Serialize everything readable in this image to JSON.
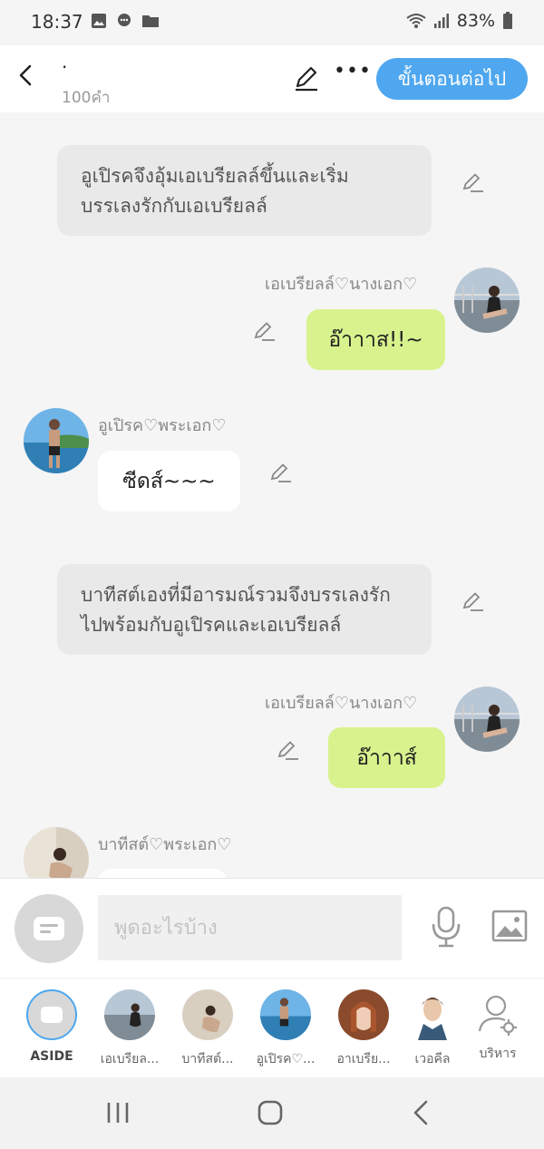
{
  "status_bar": {
    "time": "18:37",
    "battery": "83%"
  },
  "header": {
    "title": "·",
    "word_count": "100คำ",
    "next_label": "ขั้นตอนต่อไป"
  },
  "messages": {
    "narration_1": "อูเปิรคจึงอุ้มเอเบรียลล์ขึ้นและเริ่มบรรเลงรักกับเอเบรียลล์",
    "msg_1": {
      "name": "เอเบรียลล์♡นางเอก♡",
      "text": "อ๊าาาส!!~"
    },
    "msg_2": {
      "name": "อูเปิรค♡พระเอก♡",
      "text": "ซีดส์~~~"
    },
    "narration_2": "บาทีสต์เองที่มีอารมณ์รวมจึงบรรเลงรักไปพร้อมกับอูเปิรคและเอเบรียลล์",
    "msg_3": {
      "name": "เอเบรียลล์♡นางเอก♡",
      "text": "อ๊าาาส์"
    },
    "msg_4": {
      "name": "บาทีสต์♡พระเอก♡"
    }
  },
  "input": {
    "placeholder": "พูดอะไรบ้าง"
  },
  "characters": [
    {
      "label": "ASIDE"
    },
    {
      "label": "เอเบรียล..."
    },
    {
      "label": "บาทีสต์..."
    },
    {
      "label": "อูเปิรค♡..."
    },
    {
      "label": "อาเบรีย..."
    },
    {
      "label": "เวอคีล"
    },
    {
      "label": "บริหาร"
    }
  ],
  "colors": {
    "accent": "#4ea7ef",
    "bubble_right": "#d8f38d",
    "narration_bg": "#e9e9e9"
  }
}
